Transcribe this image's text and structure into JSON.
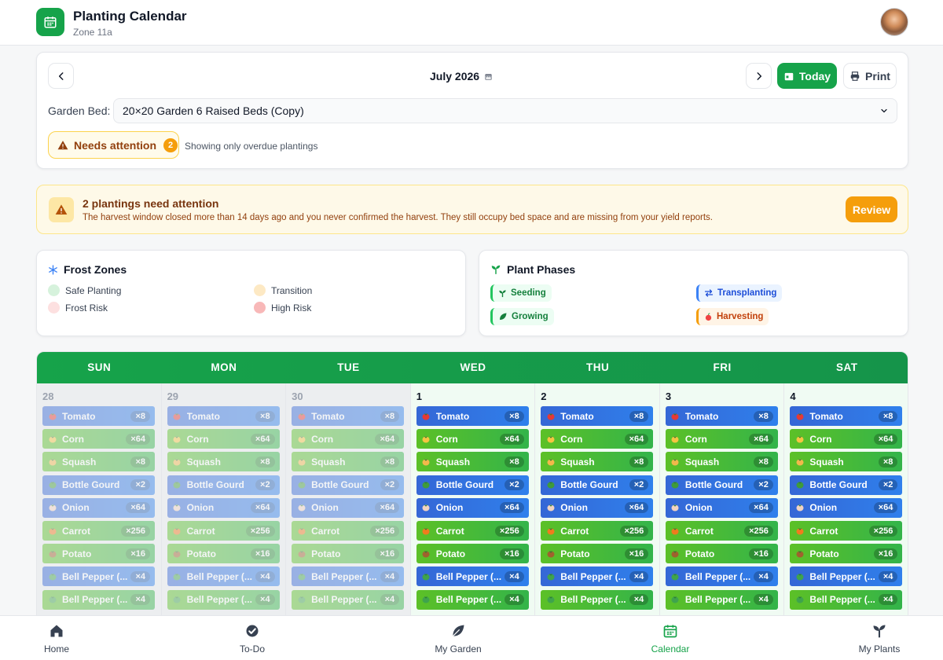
{
  "app": {
    "title": "Planting Calendar",
    "zone": "Zone 11a"
  },
  "nav": {
    "month": "July 2026",
    "today_label": "Today",
    "print_label": "Print"
  },
  "bed": {
    "label": "Garden Bed:",
    "selected": "20×20 Garden 6 Raised Beds (Copy)"
  },
  "filter": {
    "chip_label": "Needs attention",
    "count": "2",
    "note": "Showing only overdue plantings"
  },
  "alert": {
    "title": "2 plantings need attention",
    "body": "The harvest window closed more than 14 days ago and you never confirmed the harvest. They still occupy bed space and are missing from your yield reports.",
    "button": "Review"
  },
  "frost": {
    "title": "Frost Zones",
    "items": [
      {
        "label": "Safe Planting",
        "color": "#d6f2dc"
      },
      {
        "label": "Transition",
        "color": "#fde9c4"
      },
      {
        "label": "Frost Risk",
        "color": "#fde0e0"
      },
      {
        "label": "High Risk",
        "color": "#f8b8b8"
      }
    ]
  },
  "phases": {
    "title": "Plant Phases",
    "items": [
      {
        "label": "Seeding",
        "bg": "#ecfdf3",
        "fg": "#15803d",
        "border": "#22c55e",
        "icon": "sprout-icon"
      },
      {
        "label": "Transplanting",
        "bg": "#eaf3ff",
        "fg": "#1d4ed8",
        "border": "#3b82f6",
        "icon": "swap-icon"
      },
      {
        "label": "Growing",
        "bg": "#ecfdf3",
        "fg": "#15803d",
        "border": "#22c55e",
        "icon": "leaf-icon"
      },
      {
        "label": "Harvesting",
        "bg": "#fff4e6",
        "fg": "#c2410c",
        "border": "#f59e0b",
        "icon": "apple-icon"
      }
    ]
  },
  "calendar": {
    "weekdays": [
      "SUN",
      "MON",
      "TUE",
      "WED",
      "THU",
      "FRI",
      "SAT"
    ],
    "days": [
      {
        "num": "28",
        "past": true
      },
      {
        "num": "29",
        "past": true
      },
      {
        "num": "30",
        "past": true
      },
      {
        "num": "1",
        "past": false
      },
      {
        "num": "2",
        "past": false
      },
      {
        "num": "3",
        "past": false
      },
      {
        "num": "4",
        "past": false
      }
    ],
    "plants": [
      {
        "name": "Tomato",
        "count": "×8",
        "style": "blue",
        "icon": "tomato-icon",
        "icon_color": "#e53935"
      },
      {
        "name": "Corn",
        "count": "×64",
        "style": "green",
        "icon": "corn-icon",
        "icon_color": "#f6c542"
      },
      {
        "name": "Squash",
        "count": "×8",
        "style": "green",
        "icon": "squash-icon",
        "icon_color": "#f2b84b"
      },
      {
        "name": "Bottle Gourd",
        "count": "×2",
        "style": "blue",
        "icon": "gourd-icon",
        "icon_color": "#3f9b3a"
      },
      {
        "name": "Onion",
        "count": "×64",
        "style": "blue",
        "icon": "onion-icon",
        "icon_color": "#f1d3c2"
      },
      {
        "name": "Carrot",
        "count": "×256",
        "style": "green",
        "icon": "carrot-icon",
        "icon_color": "#f07b1d"
      },
      {
        "name": "Potato",
        "count": "×16",
        "style": "green",
        "icon": "potato-icon",
        "icon_color": "#a0612d"
      },
      {
        "name": "Bell Pepper (...",
        "count": "×4",
        "style": "blue",
        "icon": "pepper-icon",
        "icon_color": "#3fa34d"
      },
      {
        "name": "Bell Pepper (...",
        "count": "×4",
        "style": "green",
        "icon": "pepper-icon",
        "icon_color": "#3fa34d"
      }
    ]
  },
  "bottom_nav": [
    {
      "label": "Home",
      "icon": "home-icon",
      "active": false
    },
    {
      "label": "To-Do",
      "icon": "check-circle-icon",
      "active": false
    },
    {
      "label": "My Garden",
      "icon": "leaf-icon",
      "active": false
    },
    {
      "label": "Calendar",
      "icon": "calendar-icon",
      "active": true
    },
    {
      "label": "My Plants",
      "icon": "plant-icon",
      "active": false
    }
  ]
}
